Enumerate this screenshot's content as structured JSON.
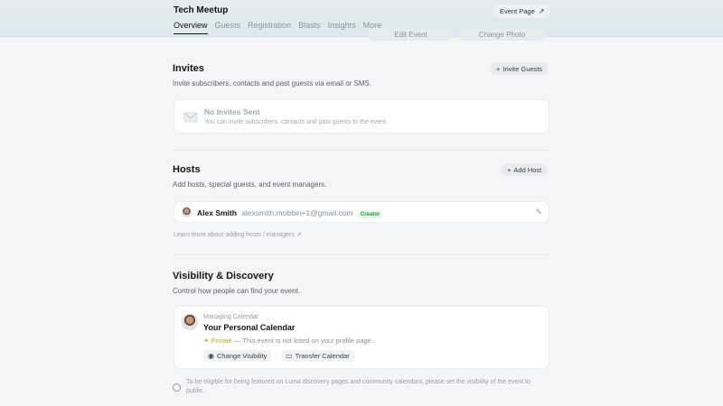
{
  "header": {
    "event_title": "Tech Meetup",
    "event_page_label": "Event Page",
    "event_page_icon": "external-arrow-icon",
    "ghost_buttons": [
      "Edit Event",
      "Change Photo"
    ],
    "tabs": [
      "Overview",
      "Guests",
      "Registration",
      "Blasts",
      "Insights",
      "More"
    ],
    "active_tab": "Overview"
  },
  "invites": {
    "title": "Invites",
    "description": "Invite subscribers, contacts and past guests via email or SMS.",
    "invite_button": "Invite Guests",
    "empty_title": "No Invites Sent",
    "empty_desc": "You can invite subscribers, contacts and past guests to the event."
  },
  "hosts": {
    "title": "Hosts",
    "description": "Add hosts, special guests, and event managers.",
    "add_button": "Add Host",
    "host_name": "Alex Smith",
    "host_email": "alexsmith.mobbin+1@gmail.com",
    "host_role": "Creator",
    "learn_more": "Learn more about adding hosts / managers ↗"
  },
  "visibility": {
    "title": "Visibility & Discovery",
    "description": "Control how people can find your event.",
    "calendar_label": "Managing Calendar",
    "calendar_name": "Your Personal Calendar",
    "privacy_label": "Private",
    "privacy_desc": "— This event is not listed on your profile page.",
    "change_visibility": "Change Visibility",
    "transfer_calendar": "Transfer Calendar",
    "footnote": "To be eligible for being featured on Luma discovery pages and community calendars, please set the visibility of the event to public."
  },
  "colors": {
    "accent_private": "#d8a20a",
    "creator_badge_bg": "#e3f7e7",
    "creator_badge_fg": "#2b9a3e"
  }
}
